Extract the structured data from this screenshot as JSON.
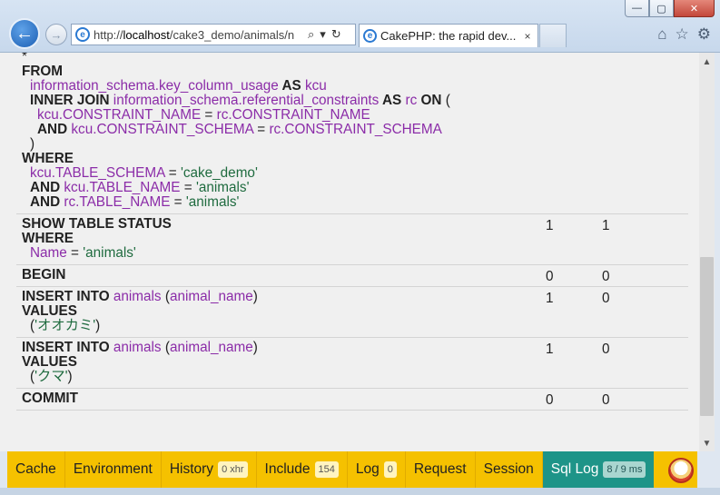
{
  "browser": {
    "url_prefix": "http://",
    "url_host": "localhost",
    "url_path": "/cake3_demo/animals/n",
    "tab_title": "CakePHP: the rapid dev...",
    "tab_close": "×",
    "window_controls": {
      "minimize": "—",
      "maximize": "▢",
      "close": "✕"
    }
  },
  "sql_log": {
    "rows": [
      {
        "lines": [
          [
            {
              "t": "*",
              "c": "plain"
            }
          ],
          [
            {
              "t": "FROM",
              "c": "kw"
            }
          ],
          [
            {
              "t": "information_schema.key_column_usage",
              "c": "id",
              "i": 1
            },
            {
              "t": " AS ",
              "c": "kw"
            },
            {
              "t": "kcu",
              "c": "id"
            }
          ],
          [
            {
              "t": "INNER JOIN ",
              "c": "kw",
              "i": 1
            },
            {
              "t": "information_schema.referential_constraints",
              "c": "id"
            },
            {
              "t": " AS ",
              "c": "kw"
            },
            {
              "t": "rc",
              "c": "id"
            },
            {
              "t": " ON ",
              "c": "kw"
            },
            {
              "t": "(",
              "c": "plain"
            }
          ],
          [
            {
              "t": "kcu.CONSTRAINT_NAME",
              "c": "id",
              "i": 2
            },
            {
              "t": " = ",
              "c": "plain"
            },
            {
              "t": "rc.CONSTRAINT_NAME",
              "c": "id"
            }
          ],
          [
            {
              "t": "AND ",
              "c": "kw",
              "i": 2
            },
            {
              "t": "kcu.CONSTRAINT_SCHEMA",
              "c": "id"
            },
            {
              "t": " = ",
              "c": "plain"
            },
            {
              "t": "rc.CONSTRAINT_SCHEMA",
              "c": "id"
            }
          ],
          [
            {
              "t": ")",
              "c": "plain",
              "i": 1
            }
          ],
          [
            {
              "t": "WHERE",
              "c": "kw"
            }
          ],
          [
            {
              "t": "kcu.TABLE_SCHEMA",
              "c": "id",
              "i": 1
            },
            {
              "t": " = ",
              "c": "plain"
            },
            {
              "t": "'cake_demo'",
              "c": "str"
            }
          ],
          [
            {
              "t": "AND ",
              "c": "kw",
              "i": 1
            },
            {
              "t": "kcu.TABLE_NAME",
              "c": "id"
            },
            {
              "t": " = ",
              "c": "plain"
            },
            {
              "t": "'animals'",
              "c": "str"
            }
          ],
          [
            {
              "t": "AND ",
              "c": "kw",
              "i": 1
            },
            {
              "t": "rc.TABLE_NAME",
              "c": "id"
            },
            {
              "t": " = ",
              "c": "plain"
            },
            {
              "t": "'animals'",
              "c": "str"
            }
          ]
        ],
        "rows_count": "",
        "took": ""
      },
      {
        "lines": [
          [
            {
              "t": "SHOW TABLE STATUS",
              "c": "kw"
            }
          ],
          [
            {
              "t": "WHERE",
              "c": "kw"
            }
          ],
          [
            {
              "t": "Name",
              "c": "id",
              "i": 1
            },
            {
              "t": " = ",
              "c": "plain"
            },
            {
              "t": "'animals'",
              "c": "str"
            }
          ]
        ],
        "rows_count": "1",
        "took": "1"
      },
      {
        "lines": [
          [
            {
              "t": "BEGIN",
              "c": "kw"
            }
          ]
        ],
        "rows_count": "0",
        "took": "0"
      },
      {
        "lines": [
          [
            {
              "t": "INSERT INTO ",
              "c": "kw"
            },
            {
              "t": "animals",
              "c": "id"
            },
            {
              "t": " (",
              "c": "plain"
            },
            {
              "t": "animal_name",
              "c": "id"
            },
            {
              "t": ")",
              "c": "plain"
            }
          ],
          [
            {
              "t": "VALUES",
              "c": "kw"
            }
          ],
          [
            {
              "t": "(",
              "c": "plain",
              "i": 1
            },
            {
              "t": "'オオカミ'",
              "c": "str"
            },
            {
              "t": ")",
              "c": "plain"
            }
          ]
        ],
        "rows_count": "1",
        "took": "0"
      },
      {
        "lines": [
          [
            {
              "t": "INSERT INTO ",
              "c": "kw"
            },
            {
              "t": "animals",
              "c": "id"
            },
            {
              "t": " (",
              "c": "plain"
            },
            {
              "t": "animal_name",
              "c": "id"
            },
            {
              "t": ")",
              "c": "plain"
            }
          ],
          [
            {
              "t": "VALUES",
              "c": "kw"
            }
          ],
          [
            {
              "t": "(",
              "c": "plain",
              "i": 1
            },
            {
              "t": "'クマ'",
              "c": "str"
            },
            {
              "t": ")",
              "c": "plain"
            }
          ]
        ],
        "rows_count": "1",
        "took": "0"
      },
      {
        "lines": [
          [
            {
              "t": "COMMIT",
              "c": "kw"
            }
          ]
        ],
        "rows_count": "0",
        "took": "0"
      }
    ]
  },
  "debug_kit": {
    "panels": [
      {
        "label": "Cache",
        "badge": ""
      },
      {
        "label": "Environment",
        "badge": ""
      },
      {
        "label": "History",
        "badge": "0 xhr"
      },
      {
        "label": "Include",
        "badge": "154"
      },
      {
        "label": "Log",
        "badge": "0"
      },
      {
        "label": "Request",
        "badge": ""
      },
      {
        "label": "Session",
        "badge": ""
      },
      {
        "label": "Sql Log",
        "badge": "8 / 9 ms",
        "active": true
      }
    ]
  },
  "colors": {
    "keyword": "#222222",
    "identifier": "#8b2ca8",
    "string": "#1f6b3f",
    "toolbar": "#f5c100",
    "toolbar_active": "#1e9488"
  }
}
